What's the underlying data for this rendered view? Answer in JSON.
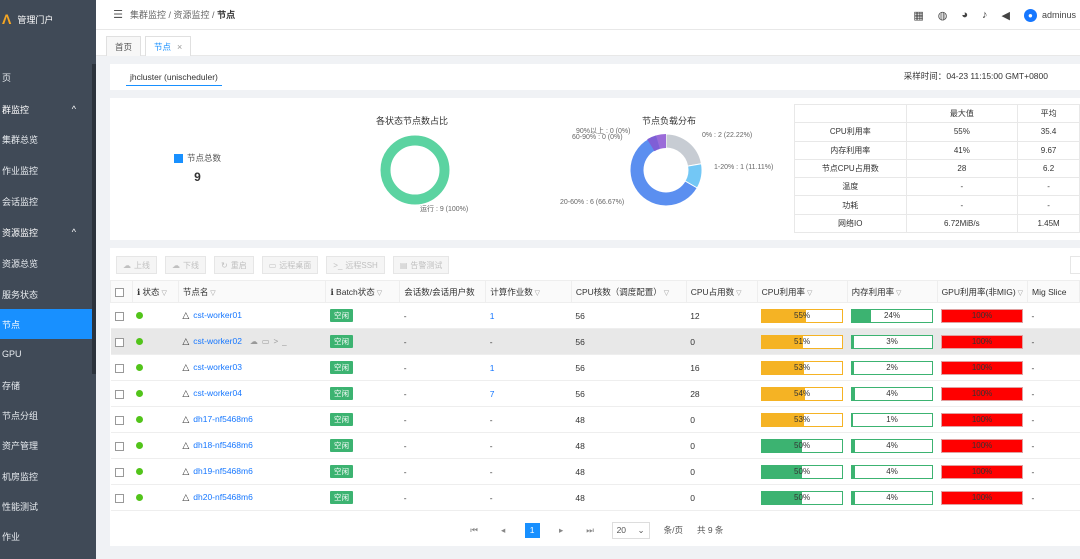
{
  "app": {
    "logo_mark": "Λ",
    "title": "管理门户"
  },
  "sidebar": {
    "items": [
      {
        "label": "页",
        "type": "item"
      },
      {
        "label": "群监控",
        "type": "group",
        "chevron": "^"
      },
      {
        "label": "集群总览",
        "type": "item"
      },
      {
        "label": "作业监控",
        "type": "item"
      },
      {
        "label": "会话监控",
        "type": "item"
      },
      {
        "label": "资源监控",
        "type": "group",
        "chevron": "^"
      },
      {
        "label": "资源总览",
        "type": "item"
      },
      {
        "label": "服务状态",
        "type": "item"
      },
      {
        "label": "节点",
        "type": "item",
        "active": true
      },
      {
        "label": "GPU",
        "type": "item"
      },
      {
        "label": "存储",
        "type": "item"
      },
      {
        "label": "节点分组",
        "type": "item"
      },
      {
        "label": "资产管理",
        "type": "item"
      },
      {
        "label": "机房监控",
        "type": "item"
      },
      {
        "label": "性能测试",
        "type": "item"
      },
      {
        "label": "作业",
        "type": "item"
      }
    ]
  },
  "header": {
    "breadcrumb": [
      "集群监控",
      "资源监控",
      "节点"
    ],
    "separator": " / ",
    "icons": [
      "calendar-icon",
      "globe-icon",
      "palette-icon",
      "bell-icon",
      "megaphone-icon"
    ],
    "user": "adminus"
  },
  "tabs": [
    {
      "label": "首页"
    },
    {
      "label": "节点",
      "closable": true,
      "active": true
    }
  ],
  "cluster": {
    "tab": "jhcluster (unischeduler)",
    "sample_time_label": "采样时间：",
    "sample_time": "04-23 11:15:00 GMT+0800"
  },
  "stats": {
    "total_label": "节点总数",
    "total_value": "9",
    "status_chart_title": "各状态节点数占比",
    "status_annotation": "运行 : 9 (100%)",
    "load_chart_title": "节点负载分布",
    "load_annotations": [
      "90%以上 : 0 (0%)",
      "60-90% : 0 (0%)",
      "0% : 2 (22.22%)",
      "1-20% : 1 (11.11%)",
      "20-60% : 6 (66.67%)"
    ],
    "table": {
      "headers": [
        "",
        "最大值",
        "平均"
      ],
      "rows": [
        [
          "CPU利用率",
          "55%",
          "35.4"
        ],
        [
          "内存利用率",
          "41%",
          "9.67"
        ],
        [
          "节点CPU占用数",
          "28",
          "6.2"
        ],
        [
          "温度",
          "-",
          "-"
        ],
        [
          "功耗",
          "-",
          "-"
        ],
        [
          "网络IO",
          "6.72MiB/s",
          "1.45M"
        ]
      ]
    }
  },
  "chart_data": [
    {
      "type": "pie",
      "title": "各状态节点数占比",
      "categories": [
        "运行"
      ],
      "values": [
        9
      ],
      "colors": [
        "#5bd3a1"
      ]
    },
    {
      "type": "pie",
      "title": "节点负载分布",
      "categories": [
        "0%",
        "1-20%",
        "20-60%",
        "60-90%",
        "90%以上"
      ],
      "values": [
        2,
        1,
        6,
        0,
        0
      ],
      "colors": [
        "#c7ccd3",
        "#73c7f5",
        "#5b8ff0",
        "#7f5fd6",
        "#9a6bd8"
      ]
    }
  ],
  "toolbar": {
    "buttons": [
      {
        "label": "上线",
        "icon": "cloud-up-icon"
      },
      {
        "label": "下线",
        "icon": "cloud-down-icon"
      },
      {
        "label": "重启",
        "icon": "refresh-icon"
      },
      {
        "label": "远程桌面",
        "icon": "monitor-icon"
      },
      {
        "label": "远程SSH",
        "icon": "terminal-icon"
      },
      {
        "label": "告警测试",
        "icon": "alarm-icon"
      }
    ]
  },
  "grid": {
    "headers": [
      "",
      "状态",
      "节点名",
      "Batch状态",
      "会话数/会话用户数",
      "计算作业数",
      "CPU核数（调度配置）",
      "CPU占用数",
      "CPU利用率",
      "内存利用率",
      "GPU利用率(非MIG)",
      "Mig Slice"
    ],
    "colors": {
      "ok": "#52c41a",
      "cpu_fill": "#f5b324",
      "mem_fill": "#3cb371",
      "gpu_fill": "#ff0000"
    },
    "rows": [
      {
        "name": "cst-worker01",
        "batch": "空闲",
        "sessions": "-",
        "jobs": "1",
        "cores": "56",
        "cpu_used": "12",
        "cpu_util": "55%",
        "cpu_val": 55,
        "cpu_color": "#f5b324",
        "mem_util": "24%",
        "mem_val": 24,
        "gpu_util": "100%",
        "gpu_val": 100,
        "mig": "-",
        "hl": false,
        "icons": false
      },
      {
        "name": "cst-worker02",
        "batch": "空闲",
        "sessions": "-",
        "jobs": "-",
        "cores": "56",
        "cpu_used": "0",
        "cpu_util": "51%",
        "cpu_val": 51,
        "cpu_color": "#f5b324",
        "mem_util": "3%",
        "mem_val": 3,
        "gpu_util": "100%",
        "gpu_val": 100,
        "mig": "-",
        "hl": true,
        "icons": true
      },
      {
        "name": "cst-worker03",
        "batch": "空闲",
        "sessions": "-",
        "jobs": "1",
        "cores": "56",
        "cpu_used": "16",
        "cpu_util": "53%",
        "cpu_val": 53,
        "cpu_color": "#f5b324",
        "mem_util": "2%",
        "mem_val": 2,
        "gpu_util": "100%",
        "gpu_val": 100,
        "mig": "-",
        "hl": false,
        "icons": false
      },
      {
        "name": "cst-worker04",
        "batch": "空闲",
        "sessions": "-",
        "jobs": "7",
        "cores": "56",
        "cpu_used": "28",
        "cpu_util": "54%",
        "cpu_val": 54,
        "cpu_color": "#f5b324",
        "mem_util": "4%",
        "mem_val": 4,
        "gpu_util": "100%",
        "gpu_val": 100,
        "mig": "-",
        "hl": false,
        "icons": false
      },
      {
        "name": "dh17-nf5468m6",
        "batch": "空闲",
        "sessions": "-",
        "jobs": "-",
        "cores": "48",
        "cpu_used": "0",
        "cpu_util": "53%",
        "cpu_val": 53,
        "cpu_color": "#f5b324",
        "mem_util": "1%",
        "mem_val": 1,
        "gpu_util": "100%",
        "gpu_val": 100,
        "mig": "-",
        "hl": false,
        "icons": false
      },
      {
        "name": "dh18-nf5468m6",
        "batch": "空闲",
        "sessions": "-",
        "jobs": "-",
        "cores": "48",
        "cpu_used": "0",
        "cpu_util": "50%",
        "cpu_val": 50,
        "cpu_color": "#3cb371",
        "mem_util": "4%",
        "mem_val": 4,
        "gpu_util": "100%",
        "gpu_val": 100,
        "mig": "-",
        "hl": false,
        "icons": false
      },
      {
        "name": "dh19-nf5468m6",
        "batch": "空闲",
        "sessions": "-",
        "jobs": "-",
        "cores": "48",
        "cpu_used": "0",
        "cpu_util": "50%",
        "cpu_val": 50,
        "cpu_color": "#3cb371",
        "mem_util": "4%",
        "mem_val": 4,
        "gpu_util": "100%",
        "gpu_val": 100,
        "mig": "-",
        "hl": false,
        "icons": false
      },
      {
        "name": "dh20-nf5468m6",
        "batch": "空闲",
        "sessions": "-",
        "jobs": "-",
        "cores": "48",
        "cpu_used": "0",
        "cpu_util": "50%",
        "cpu_val": 50,
        "cpu_color": "#3cb371",
        "mem_util": "4%",
        "mem_val": 4,
        "gpu_util": "100%",
        "gpu_val": 100,
        "mig": "-",
        "hl": false,
        "icons": false
      }
    ]
  },
  "pager": {
    "current": "1",
    "page_size": "20",
    "per_page_label": "条/页",
    "total": "共 9 条"
  }
}
